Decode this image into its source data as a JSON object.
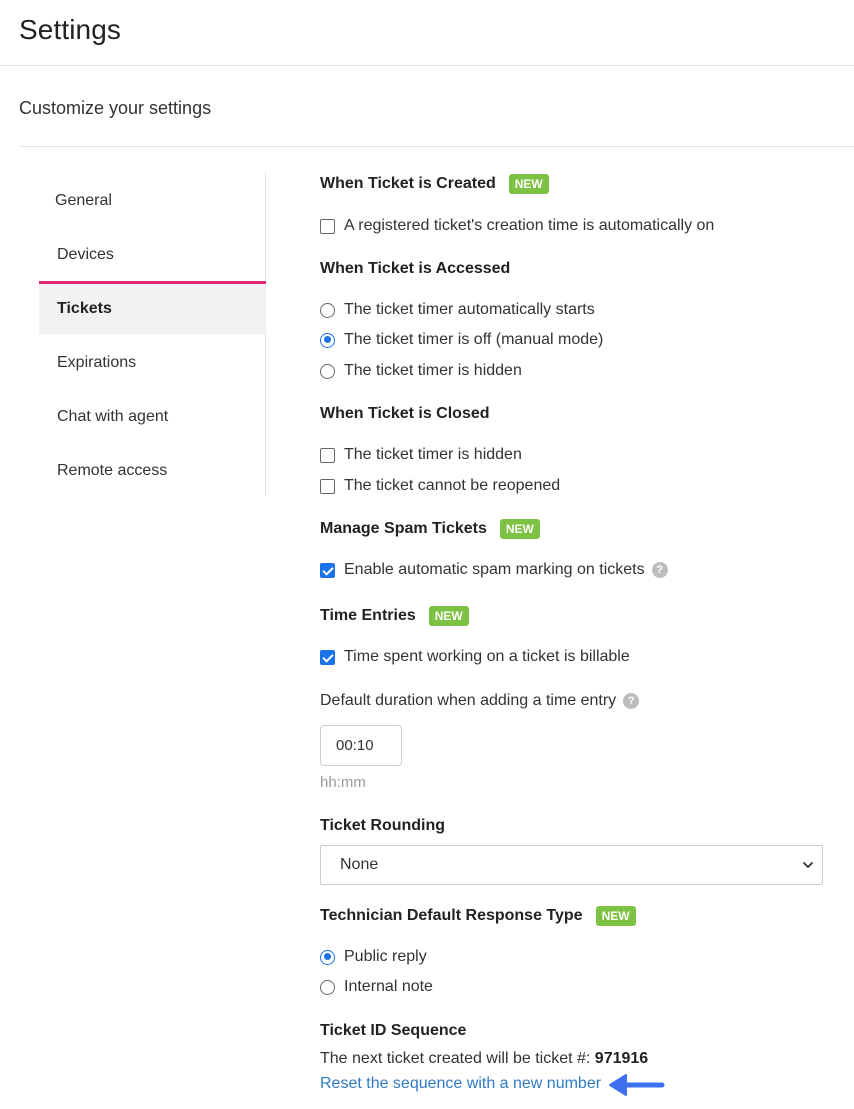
{
  "header": {
    "title": "Settings",
    "subtitle": "Customize your settings"
  },
  "sidebar": {
    "items": [
      {
        "label": "General"
      },
      {
        "label": "Devices"
      },
      {
        "label": "Tickets",
        "active": true
      },
      {
        "label": "Expirations"
      },
      {
        "label": "Chat with agent"
      },
      {
        "label": "Remote access"
      }
    ],
    "accent_color": "#e0267a"
  },
  "sections": {
    "created": {
      "title": "When Ticket is Created",
      "badge": "NEW",
      "option": {
        "label": "A registered ticket's creation time is automatically on",
        "checked": false
      }
    },
    "accessed": {
      "title": "When Ticket is Accessed",
      "options": [
        {
          "label": "The ticket timer automatically starts",
          "checked": false
        },
        {
          "label": "The ticket timer is off (manual mode)",
          "checked": true
        },
        {
          "label": "The ticket timer is hidden",
          "checked": false
        }
      ]
    },
    "closed": {
      "title": "When Ticket is Closed",
      "options": [
        {
          "label": "The ticket timer is hidden",
          "checked": false
        },
        {
          "label": "The ticket cannot be reopened",
          "checked": false
        }
      ]
    },
    "spam": {
      "title": "Manage Spam Tickets",
      "badge": "NEW",
      "option": {
        "label": "Enable automatic spam marking on tickets",
        "checked": true
      },
      "help": "?"
    },
    "time_entries": {
      "title": "Time Entries",
      "badge": "NEW",
      "option": {
        "label": "Time spent working on a ticket is billable",
        "checked": true
      },
      "duration_label": "Default duration when adding a time entry",
      "help": "?",
      "duration_value": "00:10",
      "duration_hint": "hh:mm"
    },
    "rounding": {
      "title": "Ticket Rounding",
      "selected": "None"
    },
    "response_type": {
      "title": "Technician Default Response Type",
      "badge": "NEW",
      "options": [
        {
          "label": "Public reply",
          "checked": true
        },
        {
          "label": "Internal note",
          "checked": false
        }
      ]
    },
    "id_sequence": {
      "title": "Ticket ID Sequence",
      "next_text": "The next ticket created will be ticket #:",
      "next_number": "971916",
      "reset_link": "Reset the sequence with a new number"
    }
  },
  "colors": {
    "badge": "#7dc242",
    "check": "#1a73e8",
    "link": "#2f7bc4",
    "arrow": "#3d6ff0"
  },
  "icons": {
    "help": "question-circle-icon",
    "select_arrow": "chevron-down-icon",
    "pointer": "arrow-left-icon"
  }
}
